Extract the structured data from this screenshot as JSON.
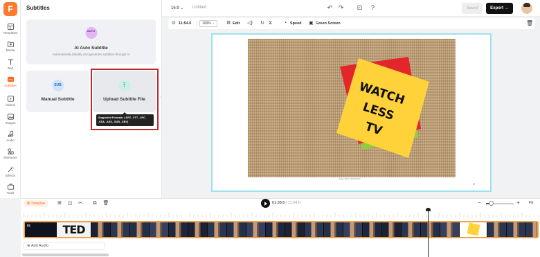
{
  "app": {
    "logo_letter": "F"
  },
  "sidebar": {
    "items": [
      {
        "label": "Templates",
        "icon": "templates-icon"
      },
      {
        "label": "Media",
        "icon": "media-icon"
      },
      {
        "label": "Text",
        "icon": "text-icon"
      },
      {
        "label": "Subtitles",
        "icon": "subtitles-icon",
        "active": true
      },
      {
        "label": "Videos",
        "icon": "videos-icon"
      },
      {
        "label": "Images",
        "icon": "images-icon"
      },
      {
        "label": "Audio",
        "icon": "audio-icon"
      },
      {
        "label": "Elements",
        "icon": "elements-icon"
      },
      {
        "label": "Effects",
        "icon": "effects-icon"
      },
      {
        "label": "Tools",
        "icon": "tools-icon"
      }
    ]
  },
  "panel": {
    "title": "Subtitles",
    "ai_card": {
      "icon_text": "AUTO",
      "title": "AI Auto Subtitle",
      "desc": "Automatically identify and generate subtitles through AI"
    },
    "manual_card": {
      "icon_text": "SUB",
      "title": "Manual Subtitle"
    },
    "upload_card": {
      "icon_text": "⤒",
      "title": "Upload Subtitle File"
    },
    "tooltip": "Supported Formats: (.SRT, .VTT, .LRC, .SSA, .ASS, .SUB, .SBV)"
  },
  "topbar": {
    "ratio": "16:9",
    "doc_title": "Untitled",
    "saved": "Saved",
    "export": "Export →"
  },
  "toolbar": {
    "duration": "11:54.0",
    "zoom": "100%",
    "edit": "Edit",
    "speed": "Speed",
    "green_screen": "Green Screen"
  },
  "canvas": {
    "sticky_note_text": [
      "WATCH",
      "LESS",
      "TV"
    ],
    "credit": "Image courtesy Shutterstock",
    "page_number": "3"
  },
  "timeline": {
    "tag": "Timeline",
    "current_time": "01:38.6",
    "total_time": "/ 11:54.0",
    "fit": "Fit",
    "track_label": "01",
    "add_audio": "Add Audio"
  }
}
